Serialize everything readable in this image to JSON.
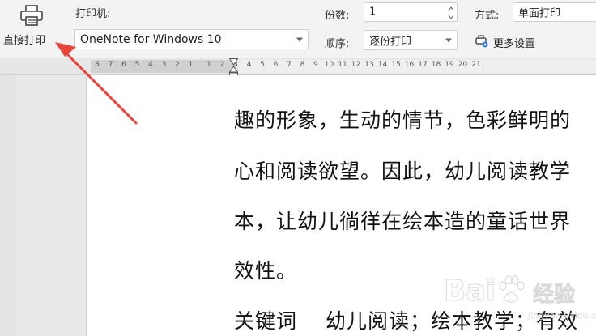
{
  "toolbar": {
    "direct_print_label": "直接打印",
    "printer_label": "打印机:",
    "printer_value": "OneNote for Windows 10",
    "copies_label": "份数:",
    "copies_value": "1",
    "order_label": "顺序:",
    "order_value": "逐份打印",
    "mode_label": "方式:",
    "mode_value": "单面打印",
    "more_settings_label": "更多设置"
  },
  "ruler": {
    "ticks": [
      "8",
      "7",
      "6",
      "5",
      "4",
      "3",
      "2",
      "1",
      "1",
      "2",
      "3",
      "4",
      "5",
      "6",
      "7",
      "8",
      "9",
      "10",
      "11",
      "12",
      "13",
      "14",
      "15",
      "16",
      "17",
      "18",
      "19",
      "20",
      "21"
    ]
  },
  "document": {
    "lines": [
      "趣的形象，生动的情节，色彩鲜明的",
      "心和阅读欲望。因此，幼儿阅读教学",
      "本，让幼儿徜徉在绘本造的童话世界",
      "效性。",
      "关键词　 幼儿阅读；绘本教学；有效"
    ]
  },
  "watermark": {
    "brand": "Bai",
    "jingyan": "经验",
    "url": "jingyan.baidu.com"
  },
  "colors": {
    "annotation_arrow": "#e8453c",
    "toolbar_bg": "#f3f3f3",
    "ruler_active": "#efefef"
  }
}
